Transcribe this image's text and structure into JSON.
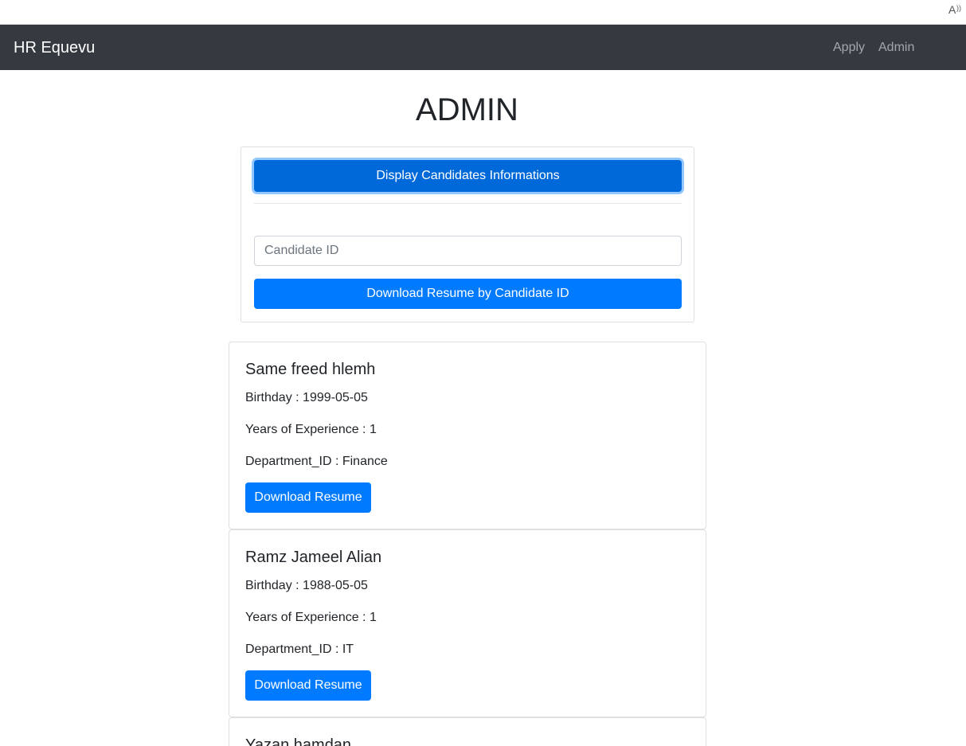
{
  "browser": {
    "read_aloud_icon": "read-aloud-icon"
  },
  "navbar": {
    "brand": "HR Equevu",
    "links": [
      "Apply",
      "Admin"
    ]
  },
  "page": {
    "title": "ADMIN"
  },
  "admin_panel": {
    "display_button_label": "Display Candidates Informations",
    "candidate_id_placeholder": "Candidate ID",
    "candidate_id_value": "",
    "download_by_id_label": "Download Resume by Candidate ID"
  },
  "field_labels": {
    "birthday": "Birthday",
    "experience": "Years of Experience",
    "department": "Department_ID",
    "separator": " : "
  },
  "candidates": [
    {
      "name": "Same freed hlemh",
      "birthday": "1999-05-05",
      "experience": "1",
      "department": "Finance",
      "download_label": "Download Resume"
    },
    {
      "name": "Ramz Jameel Alian",
      "birthday": "1988-05-05",
      "experience": "1",
      "department": "IT",
      "download_label": "Download Resume"
    },
    {
      "name": "Yazan hamdan"
    }
  ],
  "colors": {
    "navbar_bg": "#343a40",
    "primary": "#007bff",
    "primary_active": "#0069d9"
  }
}
